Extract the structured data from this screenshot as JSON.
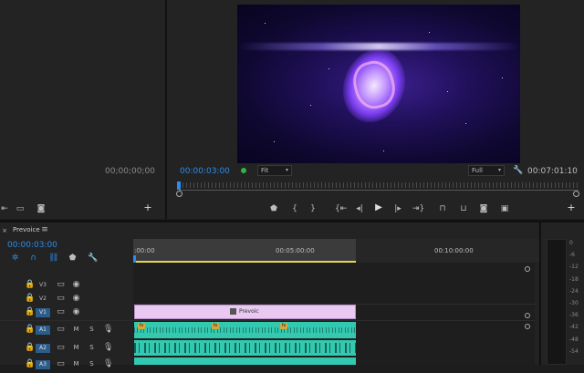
{
  "source_monitor": {
    "timecode": "00;00;00;00"
  },
  "program_monitor": {
    "current_timecode": "00:00:03:00",
    "zoom_select": "Fit",
    "resolution_select": "Full",
    "duration_timecode": "00:07:01:10"
  },
  "timeline": {
    "sequence_name": "Prevoice",
    "menu_icon": "hamburger-icon",
    "current_timecode": "00:00:03:00",
    "ruler_labels": [
      ":00:00",
      "00:05:00:00",
      "00:10:00:00"
    ],
    "tracks": [
      {
        "name": "V3",
        "type": "video",
        "active": false
      },
      {
        "name": "V2",
        "type": "video",
        "active": false
      },
      {
        "name": "V1",
        "type": "video",
        "active": true
      },
      {
        "name": "A1",
        "type": "audio",
        "active": true,
        "mute": "M",
        "solo": "S"
      },
      {
        "name": "A2",
        "type": "audio",
        "active": true,
        "mute": "M",
        "solo": "S"
      },
      {
        "name": "A3",
        "type": "audio",
        "active": true,
        "mute": "M",
        "solo": "S"
      }
    ],
    "v1_clip_label": "Prevoic",
    "fx_badge": "fx"
  },
  "audio_meter": {
    "scale": [
      "0",
      "-6",
      "-12",
      "-18",
      "-24",
      "-30",
      "-36",
      "-42",
      "-48",
      "-54"
    ]
  },
  "colors": {
    "accent_blue": "#2d8ceb",
    "video_clip": "#e9c8f2",
    "audio_clip": "#33c9b0",
    "playhead_green": "#2fb34a",
    "work_area_yellow": "#e6d84a"
  }
}
